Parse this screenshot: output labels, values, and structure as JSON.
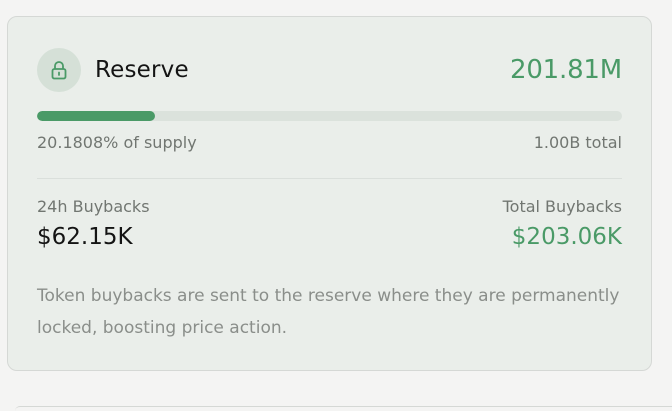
{
  "reserve": {
    "title": "Reserve",
    "amount": "201.81M",
    "supply_percent_text": "20.1808% of supply",
    "supply_fraction": 0.201808,
    "total_text": "1.00B total",
    "icon": "lock-icon",
    "accent_color": "#4a9a67"
  },
  "buybacks": {
    "day_label": "24h Buybacks",
    "day_value": "$62.15K",
    "total_label": "Total Buybacks",
    "total_value": "$203.06K"
  },
  "description": "Token buybacks are sent to the reserve where they are permanently locked, boosting price action."
}
